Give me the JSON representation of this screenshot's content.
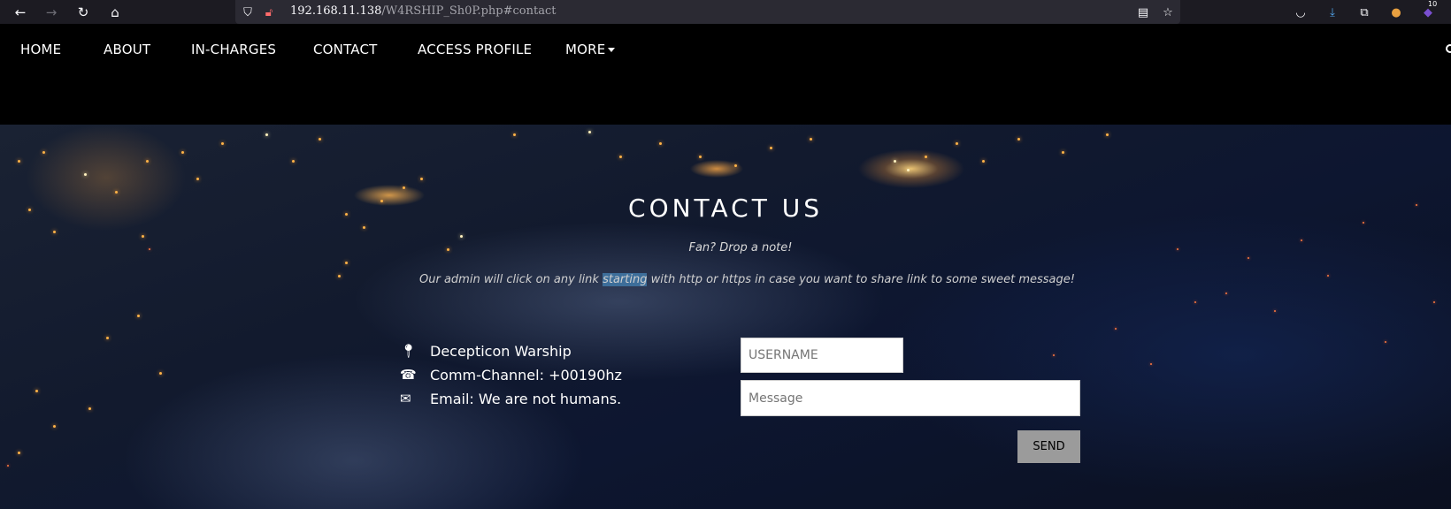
{
  "browser": {
    "url_host": "192.168.11.138",
    "url_path": "/W4RSHIP_Sh0P.php#contact",
    "badge_count": "10"
  },
  "nav": {
    "items": [
      "HOME",
      "ABOUT",
      "IN-CHARGES",
      "CONTACT",
      "ACCESS PROFILE",
      "MORE"
    ]
  },
  "contact": {
    "title": "CONTACT US",
    "subtitle": "Fan? Drop a note!",
    "note_before": "Our admin will click on any link ",
    "note_highlight": "starting",
    "note_after": " with http or https in case you want to share link to some sweet message!",
    "info": [
      {
        "icon": "map-marker-icon",
        "text": "Decepticon Warship"
      },
      {
        "icon": "phone-icon",
        "text": "Comm-Channel: +00190hz"
      },
      {
        "icon": "envelope-icon",
        "text": "Email: We are not humans."
      }
    ],
    "username_placeholder": "USERNAME",
    "message_placeholder": "Message",
    "send_label": "SEND"
  }
}
